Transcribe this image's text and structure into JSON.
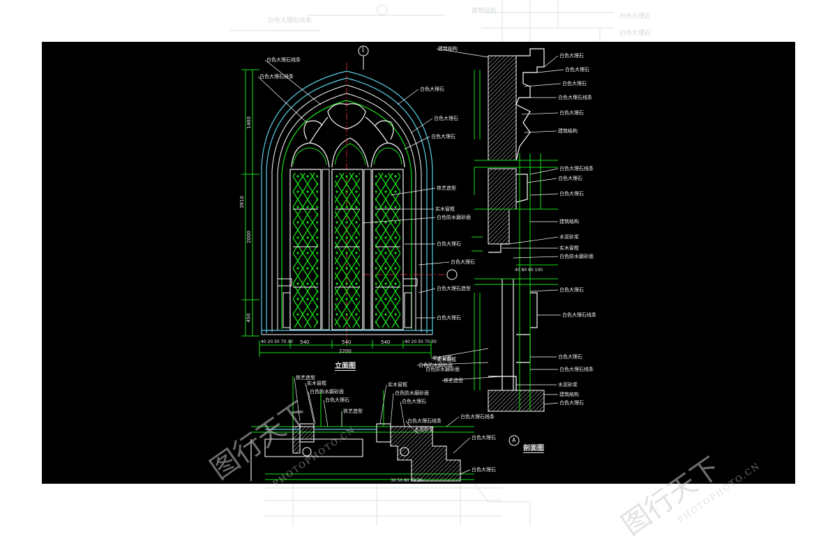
{
  "drawing": {
    "elevation_title": "立面图",
    "section_title": "剖面图",
    "section_marker": "A",
    "axis_marker": "1",
    "dims": {
      "overall_height": "3910",
      "upper_height": "1460",
      "middle_height": "2000",
      "lower_height": "450",
      "total_width": "2200",
      "panel_width": "540",
      "small_dims": "40 20 50 70 30",
      "bottom_dims": "30 50 80 70 30",
      "section_dims": "40 80 60 100"
    },
    "leaders_elevation": [
      "白色大理石线条",
      "白色大理石线条",
      "白色大理石",
      "白色大理石",
      "白色大理石",
      "铁艺造型",
      "实木窗框",
      "白色防水磨砂面",
      "白色大理石",
      "白色大理石",
      "白色大理石造型",
      "白色大理石"
    ],
    "leaders_section": [
      "建筑结构",
      "白色大理石",
      "白色大理石",
      "白色大理石",
      "白色大理石线条",
      "白色大理石",
      "建筑结构",
      "白色大理石线条",
      "白色大理石",
      "白色大理石",
      "建筑结构",
      "水泥砂浆",
      "实木窗框",
      "白色防水磨砂面",
      "白色大理石",
      "白色大理石线条",
      "白色大理石",
      "白色大理石线条",
      "水泥砂浆",
      "建筑结构",
      "白色大理石"
    ],
    "leaders_left_section": [
      "实木窗框",
      "白色防水磨砂面",
      "铁艺造型",
      "实木窗框",
      "白色防水磨砂面"
    ],
    "leaders_plan": [
      "铁艺造型",
      "实木窗框",
      "白色防水磨砂面",
      "白色大理石",
      "铁艺造型",
      "实木窗框",
      "白色防水磨砂面",
      "白色大理石",
      "白色大理石线条",
      "水泥砂浆",
      "白色大理石线条",
      "白色大理石",
      "白色大理石"
    ]
  },
  "watermark": {
    "brand_cn": "图行天下",
    "brand_en": "PHOTOPHOTO.CN"
  },
  "colors": {
    "line_green": "#18e018",
    "text_white": "#f0f0f0",
    "dim_cyan": "#3fd0e0",
    "marker_red": "#ff3030"
  }
}
